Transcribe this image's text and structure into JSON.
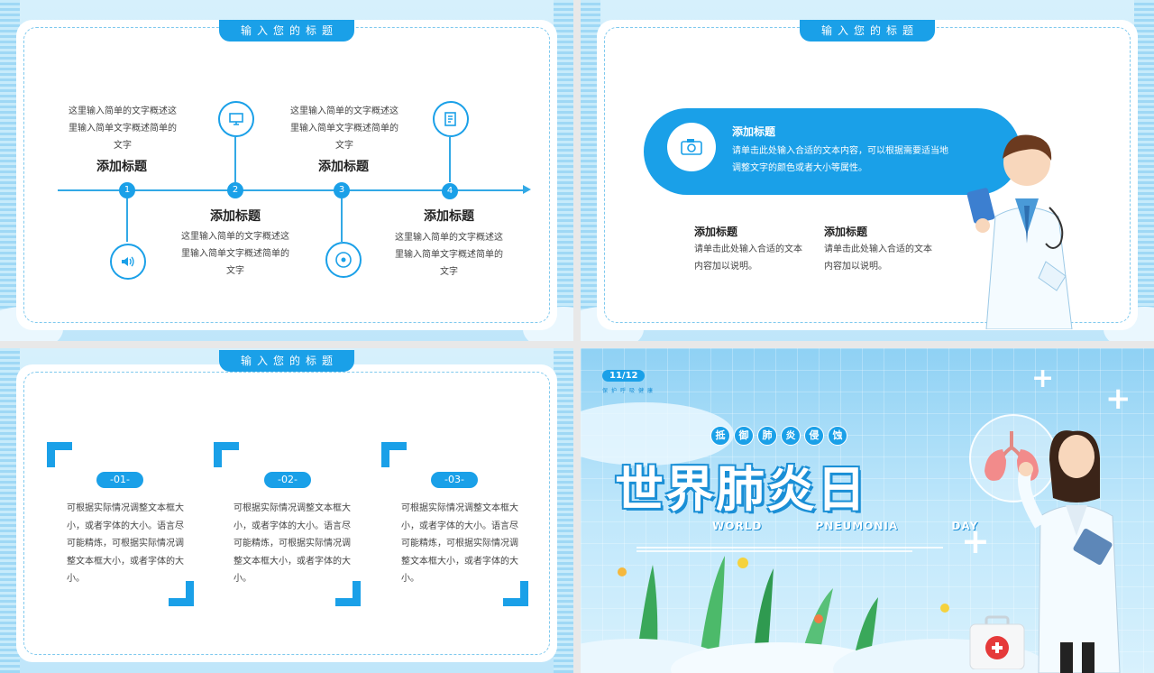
{
  "slide1": {
    "pill_title": "输入您的标题",
    "items": [
      {
        "num": "1",
        "head": "添加标题",
        "text": "这里输入简单的文字概述这里输入简单文字概述简单的文字",
        "icon": "speaker-icon"
      },
      {
        "num": "2",
        "head": "添加标题",
        "text": "这里输入简单的文字概述这里输入简单文字概述简单的文字",
        "icon": "monitor-icon"
      },
      {
        "num": "3",
        "head": "添加标题",
        "text": "这里输入简单的文字概述这里输入简单文字概述简单的文字",
        "icon": "disc-icon"
      },
      {
        "num": "4",
        "head": "添加标题",
        "text": "这里输入简单的文字概述这里输入简单文字概述简单的文字",
        "icon": "notebook-icon"
      }
    ]
  },
  "slide2": {
    "pill_title": "输入您的标题",
    "banner_head": "添加标题",
    "banner_text": "请单击此处输入合适的文本内容，可以根据需要适当地调整文字的颜色或者大小等属性。",
    "sub": [
      {
        "head": "添加标题",
        "text": "请单击此处输入合适的文本内容加以说明。"
      },
      {
        "head": "添加标题",
        "text": "请单击此处输入合适的文本内容加以说明。"
      }
    ]
  },
  "slide3": {
    "pill_title": "输入您的标题",
    "cols": [
      {
        "num": "-01-",
        "text": "可根据实际情况调整文本框大小，或者字体的大小。语言尽可能精炼，可根据实际情况调整文本框大小，或者字体的大小。"
      },
      {
        "num": "-02-",
        "text": "可根据实际情况调整文本框大小，或者字体的大小。语言尽可能精炼，可根据实际情况调整文本框大小，或者字体的大小。"
      },
      {
        "num": "-03-",
        "text": "可根据实际情况调整文本框大小，或者字体的大小。语言尽可能精炼，可根据实际情况调整文本框大小，或者字体的大小。"
      }
    ]
  },
  "slide4": {
    "date": "11/12",
    "tiny_row": "保护呼吸健康",
    "slogan": [
      "抵",
      "御",
      "肺",
      "炎",
      "侵",
      "蚀"
    ],
    "title": "世界肺炎日",
    "en_title": "WORLD PNEUMONIA DAY"
  },
  "colors": {
    "accent": "#1aa0e8",
    "bg": "#c7ebfb"
  }
}
